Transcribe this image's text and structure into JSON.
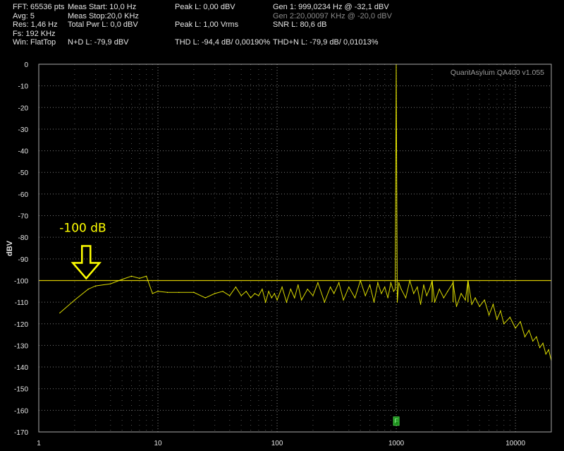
{
  "header": {
    "col1": [
      "FFT: 65536 pts",
      "Avg: 5",
      "Res: 1,46 Hz",
      "Fs: 192 KHz",
      "Win: FlatTop"
    ],
    "col2": [
      "Meas Start: 10,0 Hz",
      "Meas Stop:20,0 KHz",
      "Total Pwr L: 0,0 dBV",
      "",
      "N+D L: -79,9 dBV"
    ],
    "col3": [
      "Peak L: 0,00 dBV",
      "",
      "Peak L: 1,00 Vrms",
      "",
      "THD L: -94,4 dB/ 0,00190%"
    ],
    "col4": [
      "Gen 1: 999,0234 Hz @ -32,1  dBV",
      "Gen 2:20,00097 KHz @ -20,0  dBV",
      "SNR L: 80,6 dB",
      "",
      "THD+N L: -79,9 dB/ 0,01013%"
    ]
  },
  "chart_data": {
    "type": "line",
    "watermark": "QuantAsylum QA400 v1.055",
    "ylabel": "dBV",
    "xlabel": "",
    "x_scale": "log",
    "xlim": [
      1,
      20000
    ],
    "ylim": [
      -170,
      0
    ],
    "grid": true,
    "x_ticks": [
      "1",
      "10",
      "100",
      "1000",
      "10000"
    ],
    "y_ticks": [
      "0",
      "-10",
      "-20",
      "-30",
      "-40",
      "-50",
      "-60",
      "-70",
      "-80",
      "-90",
      "-100",
      "-110",
      "-120",
      "-130",
      "-140",
      "-150",
      "-160",
      "-170"
    ],
    "reference_line": -100,
    "annotation": {
      "text": "-100 dB",
      "arrow": "down-arrow",
      "x": 2.5,
      "y": -100
    },
    "marker": {
      "label": "F",
      "x": 1000,
      "y": -165,
      "color": "#1a8c1a"
    },
    "series_color": "#ffff00",
    "series": [
      {
        "x": [
          1.5,
          2,
          2.6,
          3,
          4,
          5,
          6,
          7,
          8,
          9,
          10,
          12,
          15,
          20,
          25,
          30,
          35,
          40,
          45,
          50,
          55,
          60,
          65,
          70,
          75,
          80,
          85,
          90,
          95,
          100,
          110,
          120,
          130,
          140,
          150,
          160,
          180,
          200,
          220,
          250,
          280,
          300,
          330,
          360,
          400,
          450,
          500,
          550,
          600,
          650,
          700,
          750,
          800,
          850,
          900,
          950,
          980,
          999,
          1020,
          1050,
          1100,
          1200,
          1300,
          1400,
          1500,
          1600,
          1700,
          1800,
          1900,
          2000,
          2100,
          2300,
          2500,
          2700,
          3000,
          3200,
          3500,
          3800,
          4000,
          4300,
          4600,
          5000,
          5500,
          6000,
          6500,
          7000,
          7500,
          8000,
          9000,
          10000,
          11000,
          12000,
          13000,
          14000,
          15000,
          16000,
          17000,
          18000,
          19000,
          20000
        ],
        "y": [
          -115,
          -109,
          -104,
          -102.5,
          -101.5,
          -99.5,
          -98,
          -99,
          -98,
          -106,
          -105,
          -105.5,
          -105.5,
          -105.5,
          -108,
          -106,
          -105,
          -107,
          -103,
          -107,
          -105,
          -108,
          -106,
          -107,
          -104,
          -110,
          -105,
          -108,
          -106,
          -109,
          -103,
          -110,
          -104,
          -108,
          -102,
          -109,
          -104,
          -107,
          -101,
          -110,
          -103,
          -106,
          -101,
          -109,
          -103,
          -108,
          -100,
          -107,
          -102,
          -110,
          -101,
          -106,
          -103,
          -108,
          -101,
          -105,
          -104,
          0,
          -110,
          -101,
          -104,
          -108,
          -100,
          -106,
          -103,
          -111,
          -102,
          -107,
          -104,
          -100,
          -110,
          -104,
          -108,
          -105,
          -101,
          -112,
          -106,
          -109,
          -100,
          -111,
          -108,
          -112,
          -109,
          -116,
          -111,
          -118,
          -114,
          -120,
          -117,
          -122,
          -119,
          -126,
          -123,
          -128,
          -126,
          -131,
          -129,
          -134,
          -132,
          -137
        ]
      }
    ]
  }
}
